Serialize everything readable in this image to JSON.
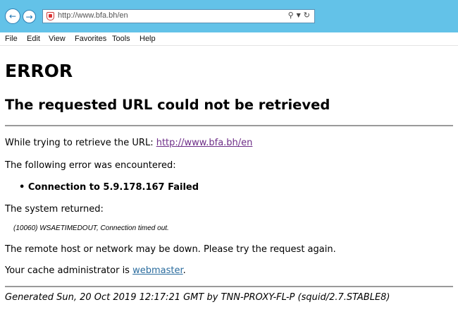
{
  "browser": {
    "url": "http://www.bfa.bh/en",
    "menu": [
      "File",
      "Edit",
      "View",
      "Favorites",
      "Tools",
      "Help"
    ]
  },
  "page": {
    "title": "ERROR",
    "subtitle": "The requested URL could not be retrieved",
    "retrieve_prefix": "While trying to retrieve the URL: ",
    "retrieve_url": "http://www.bfa.bh/en",
    "error_intro": "The following error was encountered:",
    "error_item": "Connection to 5.9.178.167 Failed",
    "system_returned": "The system returned:",
    "system_message": "(10060) WSAETIMEDOUT, Connection timed out.",
    "remote_host_note": "The remote host or network may be down. Please try the request again.",
    "cache_admin_prefix": "Your cache administrator is ",
    "cache_admin_link": "webmaster",
    "cache_admin_suffix": ".",
    "footer": "Generated Sun, 20 Oct 2019 12:17:21 GMT by TNN-PROXY-FL-P (squid/2.7.STABLE8)"
  },
  "colors": {
    "toolbar": "#63c2e8",
    "visited_link": "#6d2d87",
    "link": "#2a6c9e",
    "rule": "#9a9a9a"
  }
}
